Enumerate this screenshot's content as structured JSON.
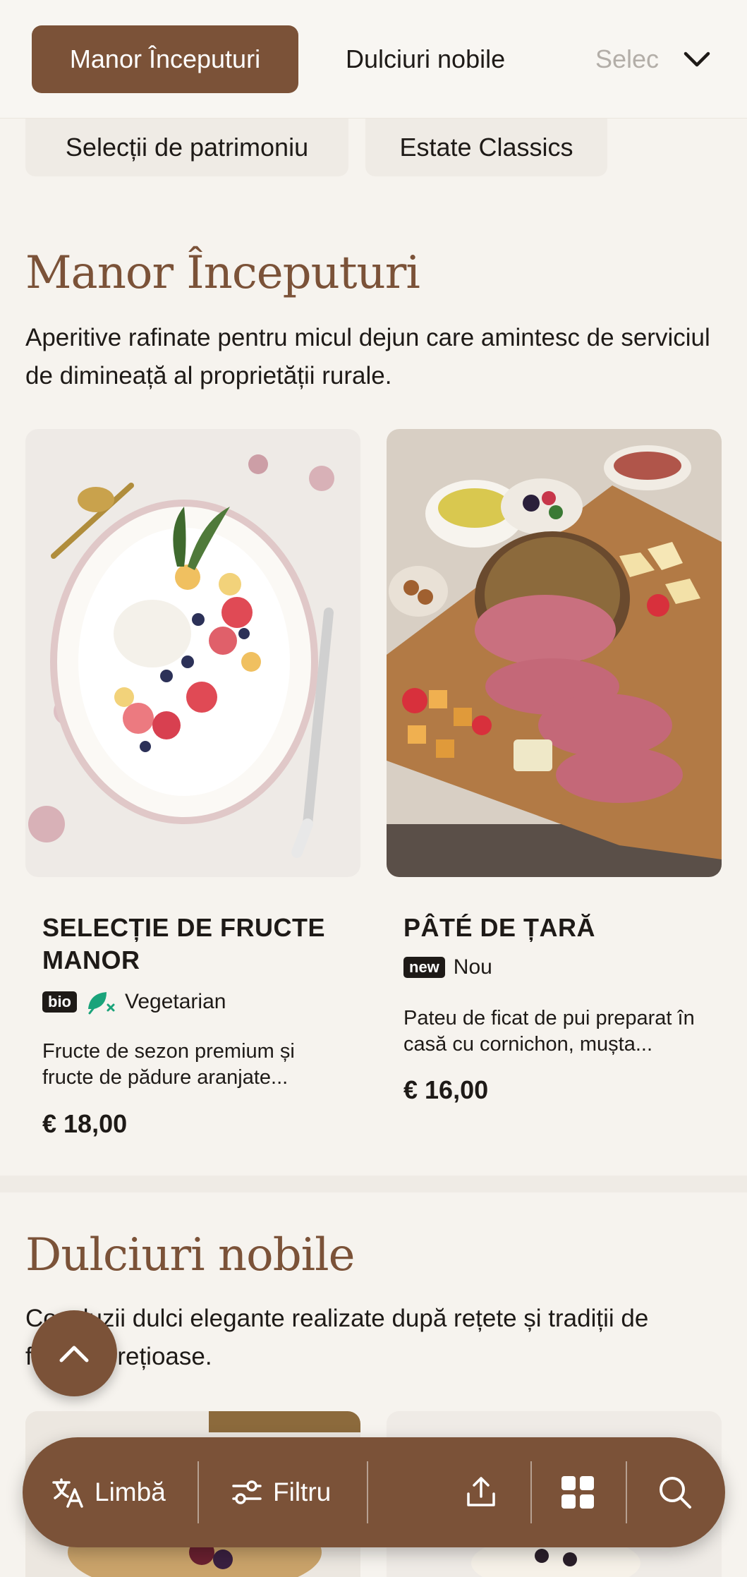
{
  "nav": {
    "categories": [
      "Manor Începuturi",
      "Dulciuri nobile",
      "Selecții de patrimoniu"
    ],
    "visible_partial": "Selec",
    "chips": [
      "Selecții de patrimoniu",
      "Estate Classics"
    ]
  },
  "sections": [
    {
      "title": "Manor Începuturi",
      "description": "Aperitive rafinate pentru micul dejun care amintesc de serviciul de dimineață al proprietății rurale.",
      "products": [
        {
          "name": "SELECȚIE DE FRUCTE MANOR",
          "badge": "bio",
          "tag_icon": "leaf-icon",
          "tag": "Vegetarian",
          "description": "Fructe de sezon premium și fructe de pădure aranjate...",
          "price": "€ 18,00"
        },
        {
          "name": "PÂTÉ DE ȚARĂ",
          "badge": "new",
          "tag": "Nou",
          "description": "Pateu de ficat de pui preparat în casă cu cornichon, mușta...",
          "price": "€ 16,00"
        }
      ]
    },
    {
      "title": "Dulciuri nobile",
      "description": "Concluzii dulci elegante realizate după rețete și tradiții de familie prețioase."
    }
  ],
  "bottom_bar": {
    "language_label": "Limbă",
    "filter_label": "Filtru",
    "icons": [
      "translate-icon",
      "filter-icon",
      "share-icon",
      "grid-icon",
      "search-icon"
    ]
  },
  "colors": {
    "accent": "#7b5238",
    "background": "#f6f3ee",
    "leaf": "#1aa37a"
  }
}
